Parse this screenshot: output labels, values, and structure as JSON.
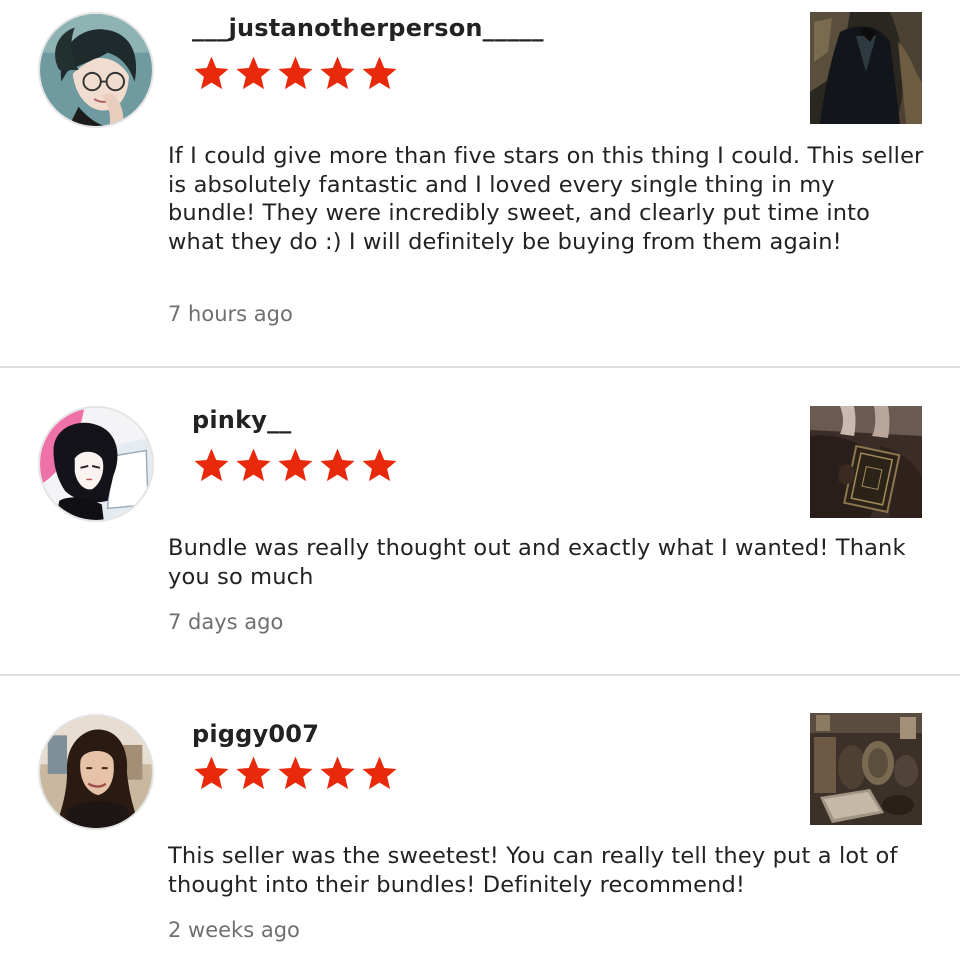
{
  "colors": {
    "star": "#e8290b",
    "text": "#222222",
    "muted": "#6f6f6f",
    "divider": "#dddddd"
  },
  "reviews": [
    {
      "username": "___justanotherperson_____",
      "rating": 5,
      "text": "If I could give more than five stars on this thing I could. This seller is absolutely fantastic and I loved every single thing in my bundle! They were incredibly sweet, and clearly put time into what they do :) I will definitely be buying from them again!",
      "time": "7 hours ago",
      "avatar_icon": "anime-man-glasses-avatar",
      "thumbnail_icon": "dark-jacket-photo"
    },
    {
      "username": "pinky__",
      "rating": 5,
      "text": "Bundle was really thought out and exactly what I wanted! Thank you so much",
      "time": "7 days ago",
      "avatar_icon": "anime-girl-pink-avatar",
      "thumbnail_icon": "book-in-hands-photo"
    },
    {
      "username": "piggy007",
      "rating": 5,
      "text": "This seller was the sweetest! You can really tell they put a lot of thought into their bundles! Definitely recommend!",
      "time": "2 weeks ago",
      "avatar_icon": "woman-portrait-avatar",
      "thumbnail_icon": "vintage-objects-photo"
    }
  ]
}
